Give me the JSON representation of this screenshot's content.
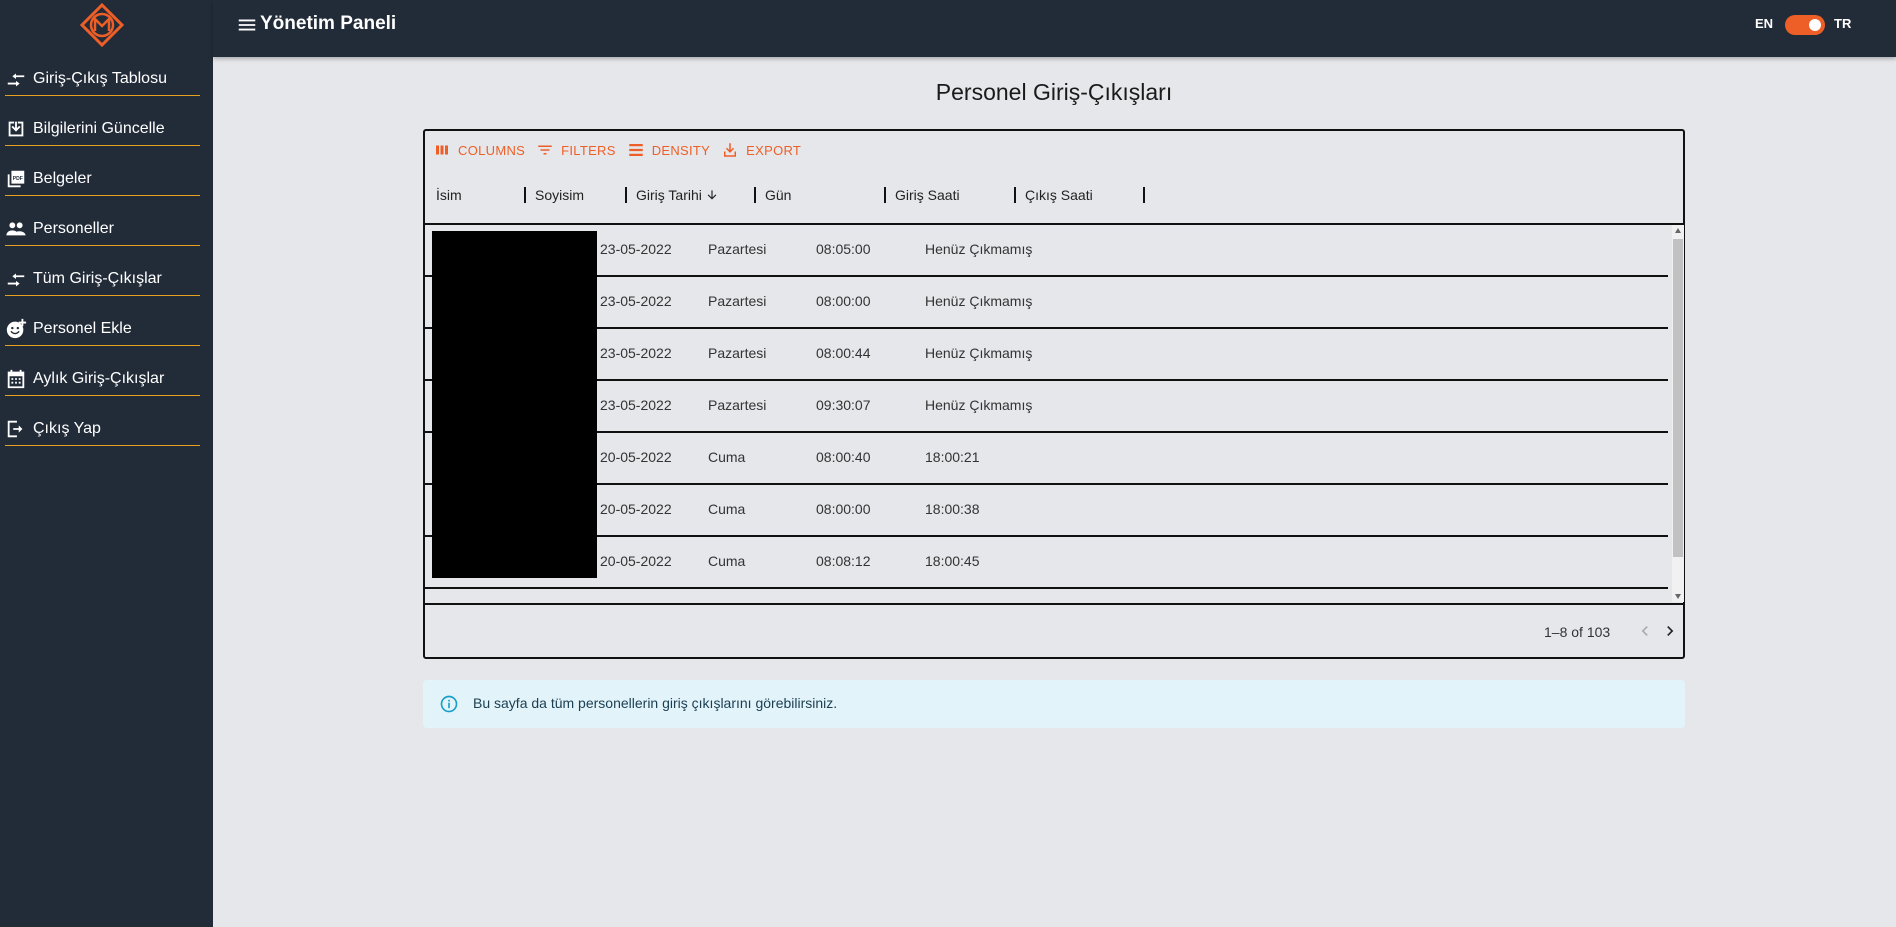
{
  "header": {
    "title": "Yönetim Paneli",
    "lang_left": "EN",
    "lang_right": "TR",
    "toggle_state": "TR"
  },
  "sidebar": {
    "items": [
      {
        "label": "Giriş-Çıkış Tablosu",
        "icon": "swap-arrows-icon"
      },
      {
        "label": "Bilgilerini Güncelle",
        "icon": "download-box-icon"
      },
      {
        "label": "Belgeler",
        "icon": "pdf-icon"
      },
      {
        "label": "Personeller",
        "icon": "people-icon"
      },
      {
        "label": "Tüm Giriş-Çıkışlar",
        "icon": "swap-arrows-icon"
      },
      {
        "label": "Personel Ekle",
        "icon": "add-emoji-icon"
      },
      {
        "label": "Aylık Giriş-Çıkışlar",
        "icon": "calendar-icon"
      },
      {
        "label": "Çıkış Yap",
        "icon": "logout-icon"
      }
    ]
  },
  "main": {
    "title": "Personel Giriş-Çıkışları",
    "toolbar": {
      "columns": "COLUMNS",
      "filters": "FILTERS",
      "density": "DENSITY",
      "export": "EXPORT"
    },
    "columns": [
      "İsim",
      "Soyisim",
      "Giriş Tarihi",
      "Gün",
      "Giriş Saati",
      "Çıkış Saati"
    ],
    "rows": [
      {
        "tarih": "23-05-2022",
        "gun": "Pazartesi",
        "giris": "08:05:00",
        "cikis": "Henüz Çıkmamış"
      },
      {
        "tarih": "23-05-2022",
        "gun": "Pazartesi",
        "giris": "08:00:00",
        "cikis": "Henüz Çıkmamış"
      },
      {
        "tarih": "23-05-2022",
        "gun": "Pazartesi",
        "giris": "08:00:44",
        "cikis": "Henüz Çıkmamış"
      },
      {
        "tarih": "23-05-2022",
        "gun": "Pazartesi",
        "giris": "09:30:07",
        "cikis": "Henüz Çıkmamış"
      },
      {
        "tarih": "20-05-2022",
        "gun": "Cuma",
        "giris": "08:00:40",
        "cikis": "18:00:21"
      },
      {
        "tarih": "20-05-2022",
        "gun": "Cuma",
        "giris": "08:00:00",
        "cikis": "18:00:38"
      },
      {
        "tarih": "20-05-2022",
        "gun": "Cuma",
        "giris": "08:08:12",
        "cikis": "18:00:45"
      }
    ],
    "pagination": "1–8 of 103",
    "info": "Bu sayfa da tüm personellerin giriş çıkışlarını görebilirsiniz."
  },
  "colors": {
    "sidebar_bg": "#222b38",
    "accent": "#ee5f27",
    "divider": "#e8a020",
    "info_bg": "#e3f3fa"
  }
}
